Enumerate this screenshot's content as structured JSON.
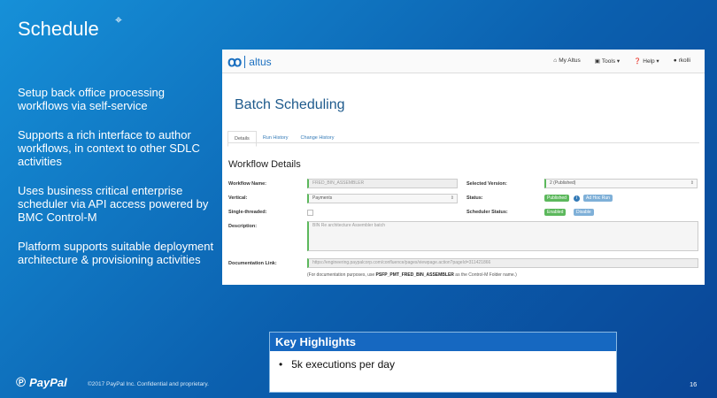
{
  "slide": {
    "title": "Schedule",
    "bullets": [
      "Setup back office processing workflows via self-service",
      "Supports a rich interface to author workflows, in context to other SDLC activities",
      "Uses business critical enterprise scheduler via API access powered by BMC Control-M",
      "Platform supports suitable deployment architecture & provisioning activities"
    ],
    "highlights_title": "Key Highlights",
    "highlights": [
      "5k executions per day"
    ],
    "footer_logo": "PayPal",
    "copyright": "©2017 PayPal Inc. Confidential and proprietary.",
    "page_number": "16"
  },
  "app": {
    "logo_text": "altus",
    "nav": {
      "my_altus": "My Altus",
      "tools": "Tools ▾",
      "help": "Help ▾",
      "user": "rkolli"
    },
    "page_title": "Batch Scheduling",
    "tabs": [
      "Details",
      "Run History",
      "Change History"
    ],
    "section_title": "Workflow Details",
    "labels": {
      "workflow_name": "Workflow Name:",
      "vertical": "Vertical:",
      "single_threaded": "Single-threaded:",
      "description": "Description:",
      "doc_link": "Documentation Link:",
      "selected_version": "Selected Version:",
      "status": "Status:",
      "scheduler_status": "Scheduler Status:"
    },
    "values": {
      "workflow_name": "FRED_BIN_ASSEMBLER",
      "vertical": "Payments",
      "description": "BIN Re architecture Assembler batch",
      "doc_link": "https://engineering.paypalcorp.com/confluence/pages/viewpage.action?pageId=311421866",
      "selected_version": "2 (Published)",
      "status_badge": "Published",
      "ad_hoc_button": "Ad Hoc Run",
      "scheduler_badge": "Enabled",
      "disable_button": "Disable"
    },
    "note_prefix": "(For documentation purposes, use ",
    "note_code": "PSFP_PMT_FRED_BIN_ASSEMBLER",
    "note_suffix": " as the Control-M Folder name.)"
  }
}
